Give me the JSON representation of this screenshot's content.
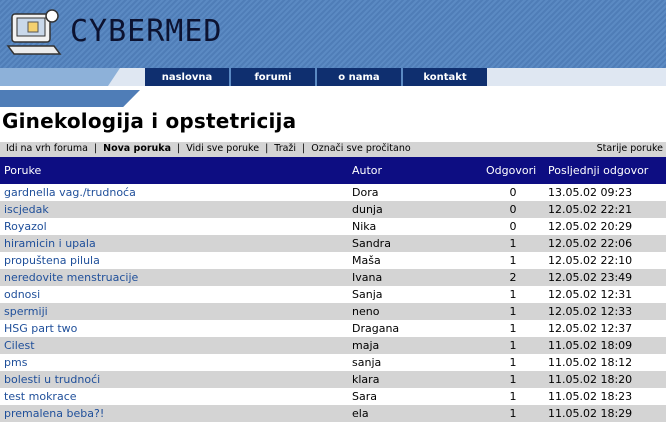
{
  "site": {
    "logo_text": "CYBERMED"
  },
  "nav": [
    "naslovna",
    "forumi",
    "o nama",
    "kontakt"
  ],
  "page_title": "Ginekologija i opstetricija",
  "toolbar": {
    "links": [
      "Idi na vrh foruma",
      "Nova poruka",
      "Vidi sve poruke",
      "Traži",
      "Označi sve pročitano"
    ],
    "right": "Starije poruke"
  },
  "table": {
    "headers": {
      "poruke": "Poruke",
      "autor": "Autor",
      "odgovori": "Odgovori",
      "posljednji": "Posljednji odgovor"
    },
    "rows": [
      {
        "subject": "gardnella vag./trudnoća",
        "author": "Dora",
        "replies": "0",
        "last": "13.05.02 09:23"
      },
      {
        "subject": "iscjedak",
        "author": "dunja",
        "replies": "0",
        "last": "12.05.02 22:21"
      },
      {
        "subject": "Royazol",
        "author": "Nika",
        "replies": "0",
        "last": "12.05.02 20:29"
      },
      {
        "subject": "hiramicin i upala",
        "author": "Sandra",
        "replies": "1",
        "last": "12.05.02 22:06"
      },
      {
        "subject": "propuštena pilula",
        "author": "Maša",
        "replies": "1",
        "last": "12.05.02 22:10"
      },
      {
        "subject": "neredovite menstruacije",
        "author": "Ivana",
        "replies": "2",
        "last": "12.05.02 23:49"
      },
      {
        "subject": "odnosi",
        "author": "Sanja",
        "replies": "1",
        "last": "12.05.02 12:31"
      },
      {
        "subject": "spermiji",
        "author": "neno",
        "replies": "1",
        "last": "12.05.02 12:33"
      },
      {
        "subject": "HSG part two",
        "author": "Dragana",
        "replies": "1",
        "last": "12.05.02 12:37"
      },
      {
        "subject": "Cilest",
        "author": "maja",
        "replies": "1",
        "last": "11.05.02 18:09"
      },
      {
        "subject": "pms",
        "author": "sanja",
        "replies": "1",
        "last": "11.05.02 18:12"
      },
      {
        "subject": "bolesti u trudnoći",
        "author": "klara",
        "replies": "1",
        "last": "11.05.02 18:20"
      },
      {
        "subject": "test mokrace",
        "author": "Sara",
        "replies": "1",
        "last": "11.05.02 18:23"
      },
      {
        "subject": "premalena beba?!",
        "author": "ela",
        "replies": "1",
        "last": "11.05.02 18:29"
      }
    ]
  },
  "colors": {
    "banner": "#5b8ac3",
    "nav": "#0f2f6f",
    "table_header": "#0d0d82",
    "link": "#1f4f9a",
    "row_alt": "#d4d4d4"
  }
}
